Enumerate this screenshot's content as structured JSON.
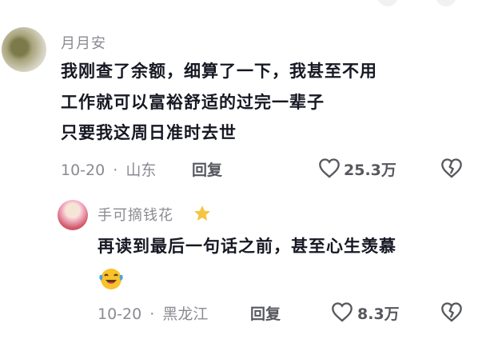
{
  "comments": [
    {
      "username": "月月安",
      "text_lines": [
        "我刚查了余额，细算了一下，我甚至不用",
        "工作就可以富裕舒适的过完一辈子",
        "只要我这周日准时去世"
      ],
      "date": "10-20",
      "separator": "·",
      "location": "山东",
      "reply_label": "回复",
      "likes": "25.3万"
    }
  ],
  "reply": {
    "username": "手可摘钱花",
    "badge_icon": "star-icon",
    "text": "再读到最后一句话之前，甚至心生羡慕",
    "emoji": "laughing-crying-emoji",
    "date": "10-20",
    "separator": "·",
    "location": "黑龙江",
    "reply_label": "回复",
    "likes": "8.3万"
  },
  "colors": {
    "username": "#8a8b91",
    "text": "#161823",
    "meta": "#8a8b91",
    "star": "#f5c542"
  }
}
